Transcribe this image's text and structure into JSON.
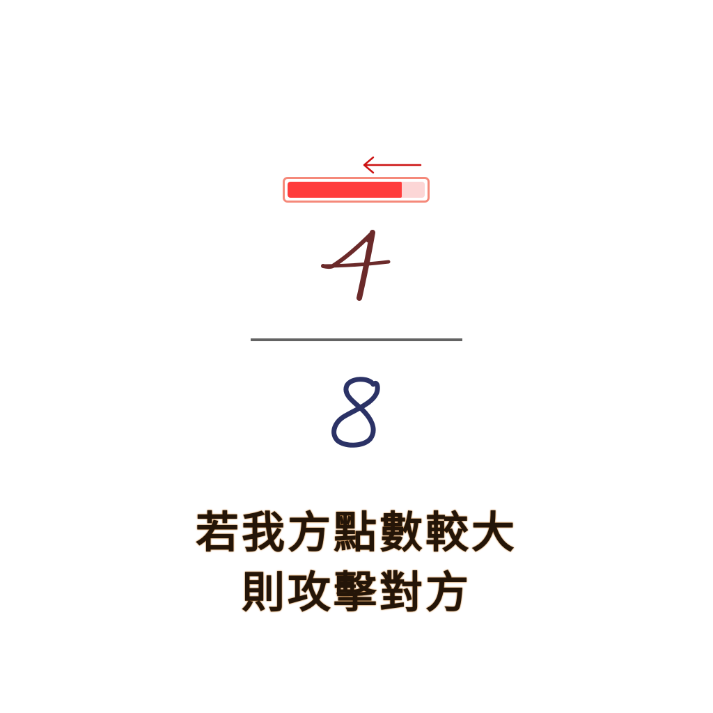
{
  "health": {
    "fraction": 0.83,
    "fill_color": "#ff3c3c",
    "track_color": "#fcd6d6",
    "border_color": "#f5897a"
  },
  "direction": {
    "icon": "left-arrow-icon",
    "color": "#cc1111"
  },
  "enemy": {
    "value": "4",
    "color": "#6b2a2a"
  },
  "player": {
    "value": "8",
    "color": "#2b3266"
  },
  "rule": {
    "line1": "若我方點數較大",
    "line2": "則攻擊對方"
  }
}
